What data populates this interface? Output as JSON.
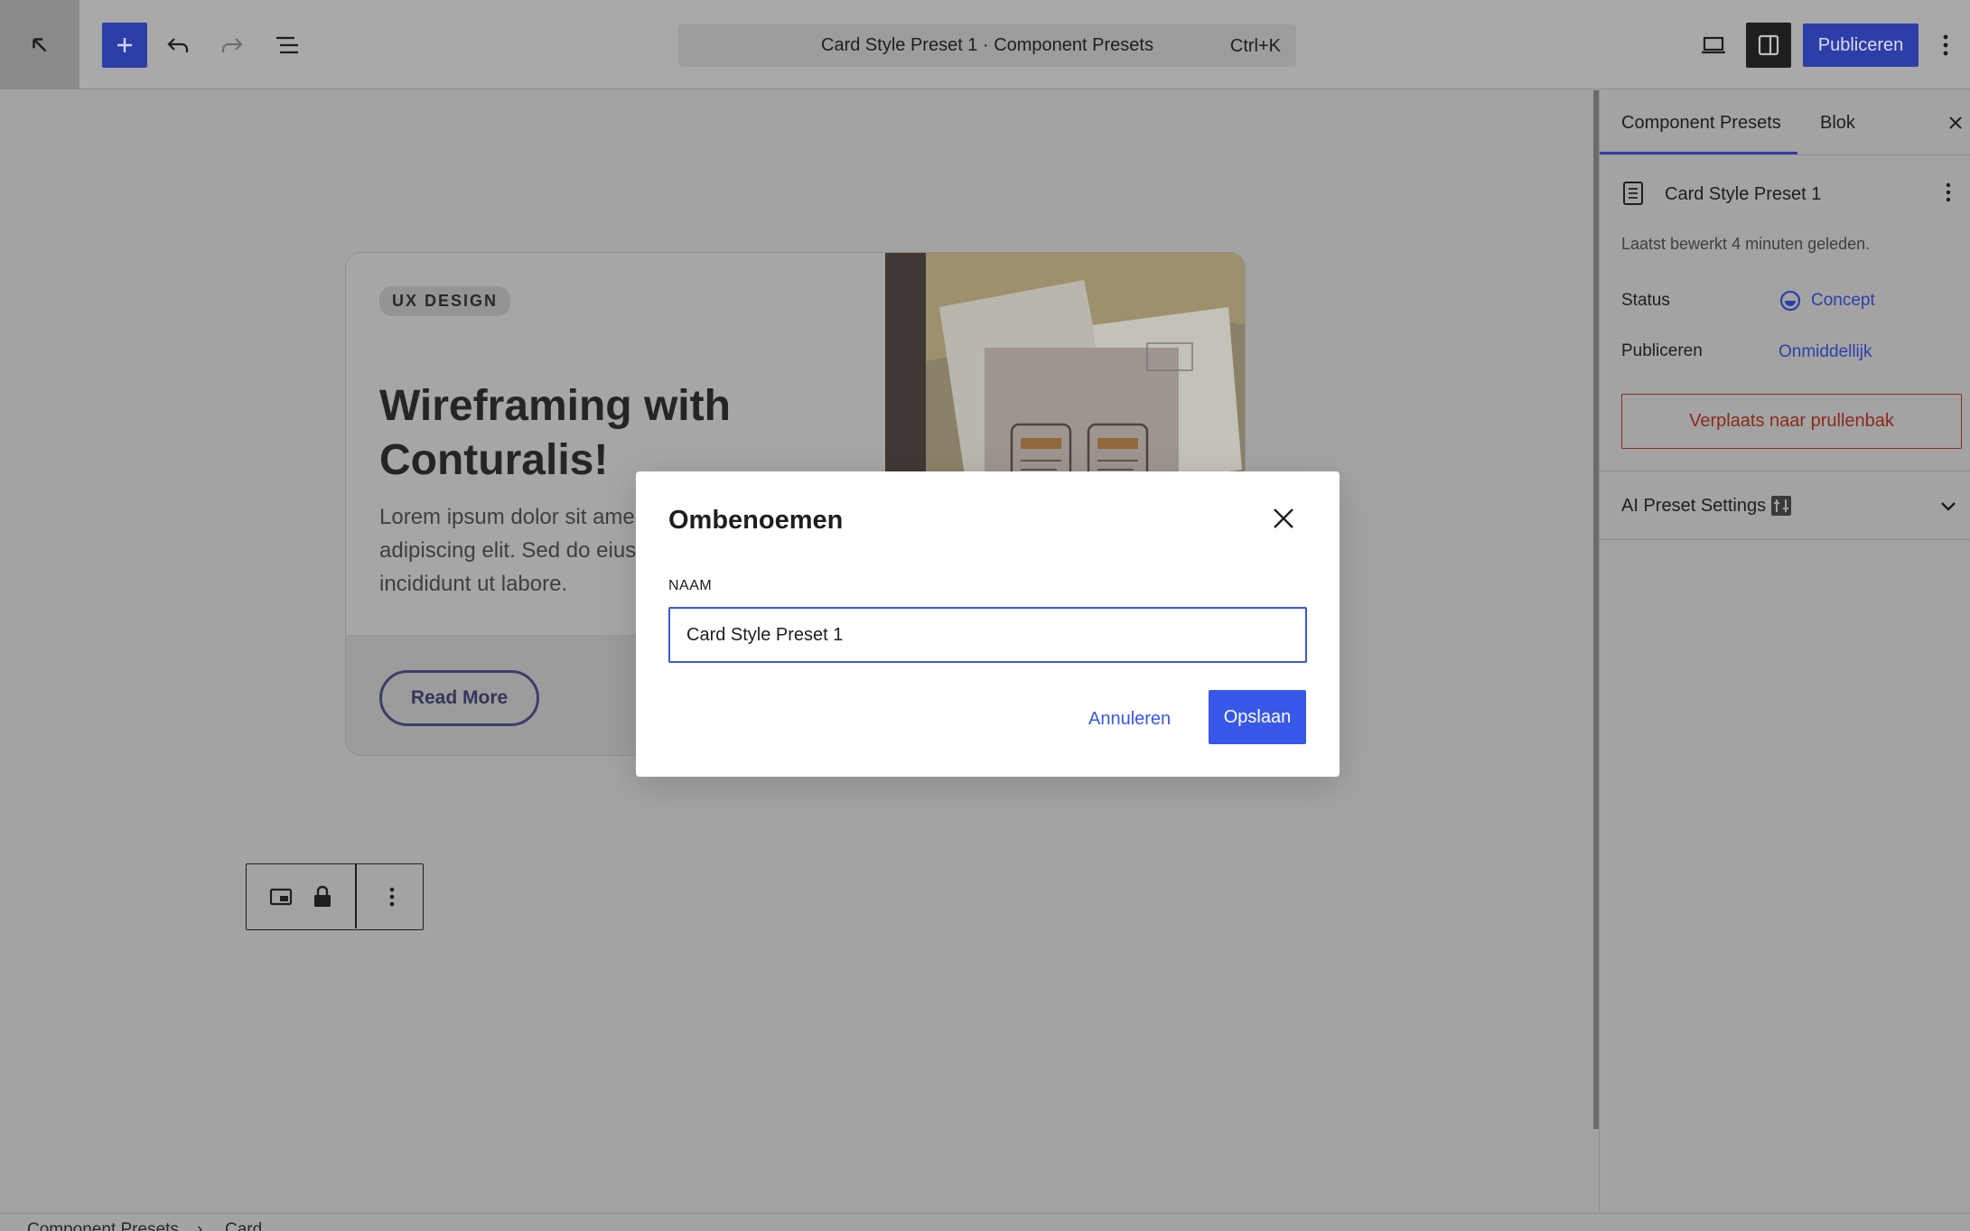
{
  "toolbar": {
    "command_title": "Card Style Preset 1 · Component Presets",
    "command_shortcut": "Ctrl+K",
    "publish_label": "Publiceren"
  },
  "card": {
    "badge": "UX DESIGN",
    "title": "Wireframing with Conturalis!",
    "text_lines": [
      "Lorem ipsum dolor sit ame",
      "adipiscing elit. Sed do eius",
      "incididunt ut labore."
    ],
    "button_label": "Read More"
  },
  "breadcrumb": {
    "items": [
      "Component Presets",
      "Card"
    ]
  },
  "sidebar": {
    "tabs": [
      "Component Presets",
      "Blok"
    ],
    "doc_title": "Card Style Preset 1",
    "last_edited": "Laatst bewerkt 4 minuten geleden.",
    "status_label": "Status",
    "status_value": "Concept",
    "publish_label": "Publiceren",
    "publish_value": "Onmiddellijk",
    "trash_label": "Verplaats naar prullenbak",
    "section_title": "AI Preset Settings"
  },
  "modal": {
    "title": "Ombenoemen",
    "field_label": "NAAM",
    "input_value": "Card Style Preset 1",
    "cancel_label": "Annuleren",
    "save_label": "Opslaan"
  },
  "colors": {
    "accent": "#3858e9",
    "overlay": "#a3a3a3",
    "danger": "#8b2a1c"
  }
}
